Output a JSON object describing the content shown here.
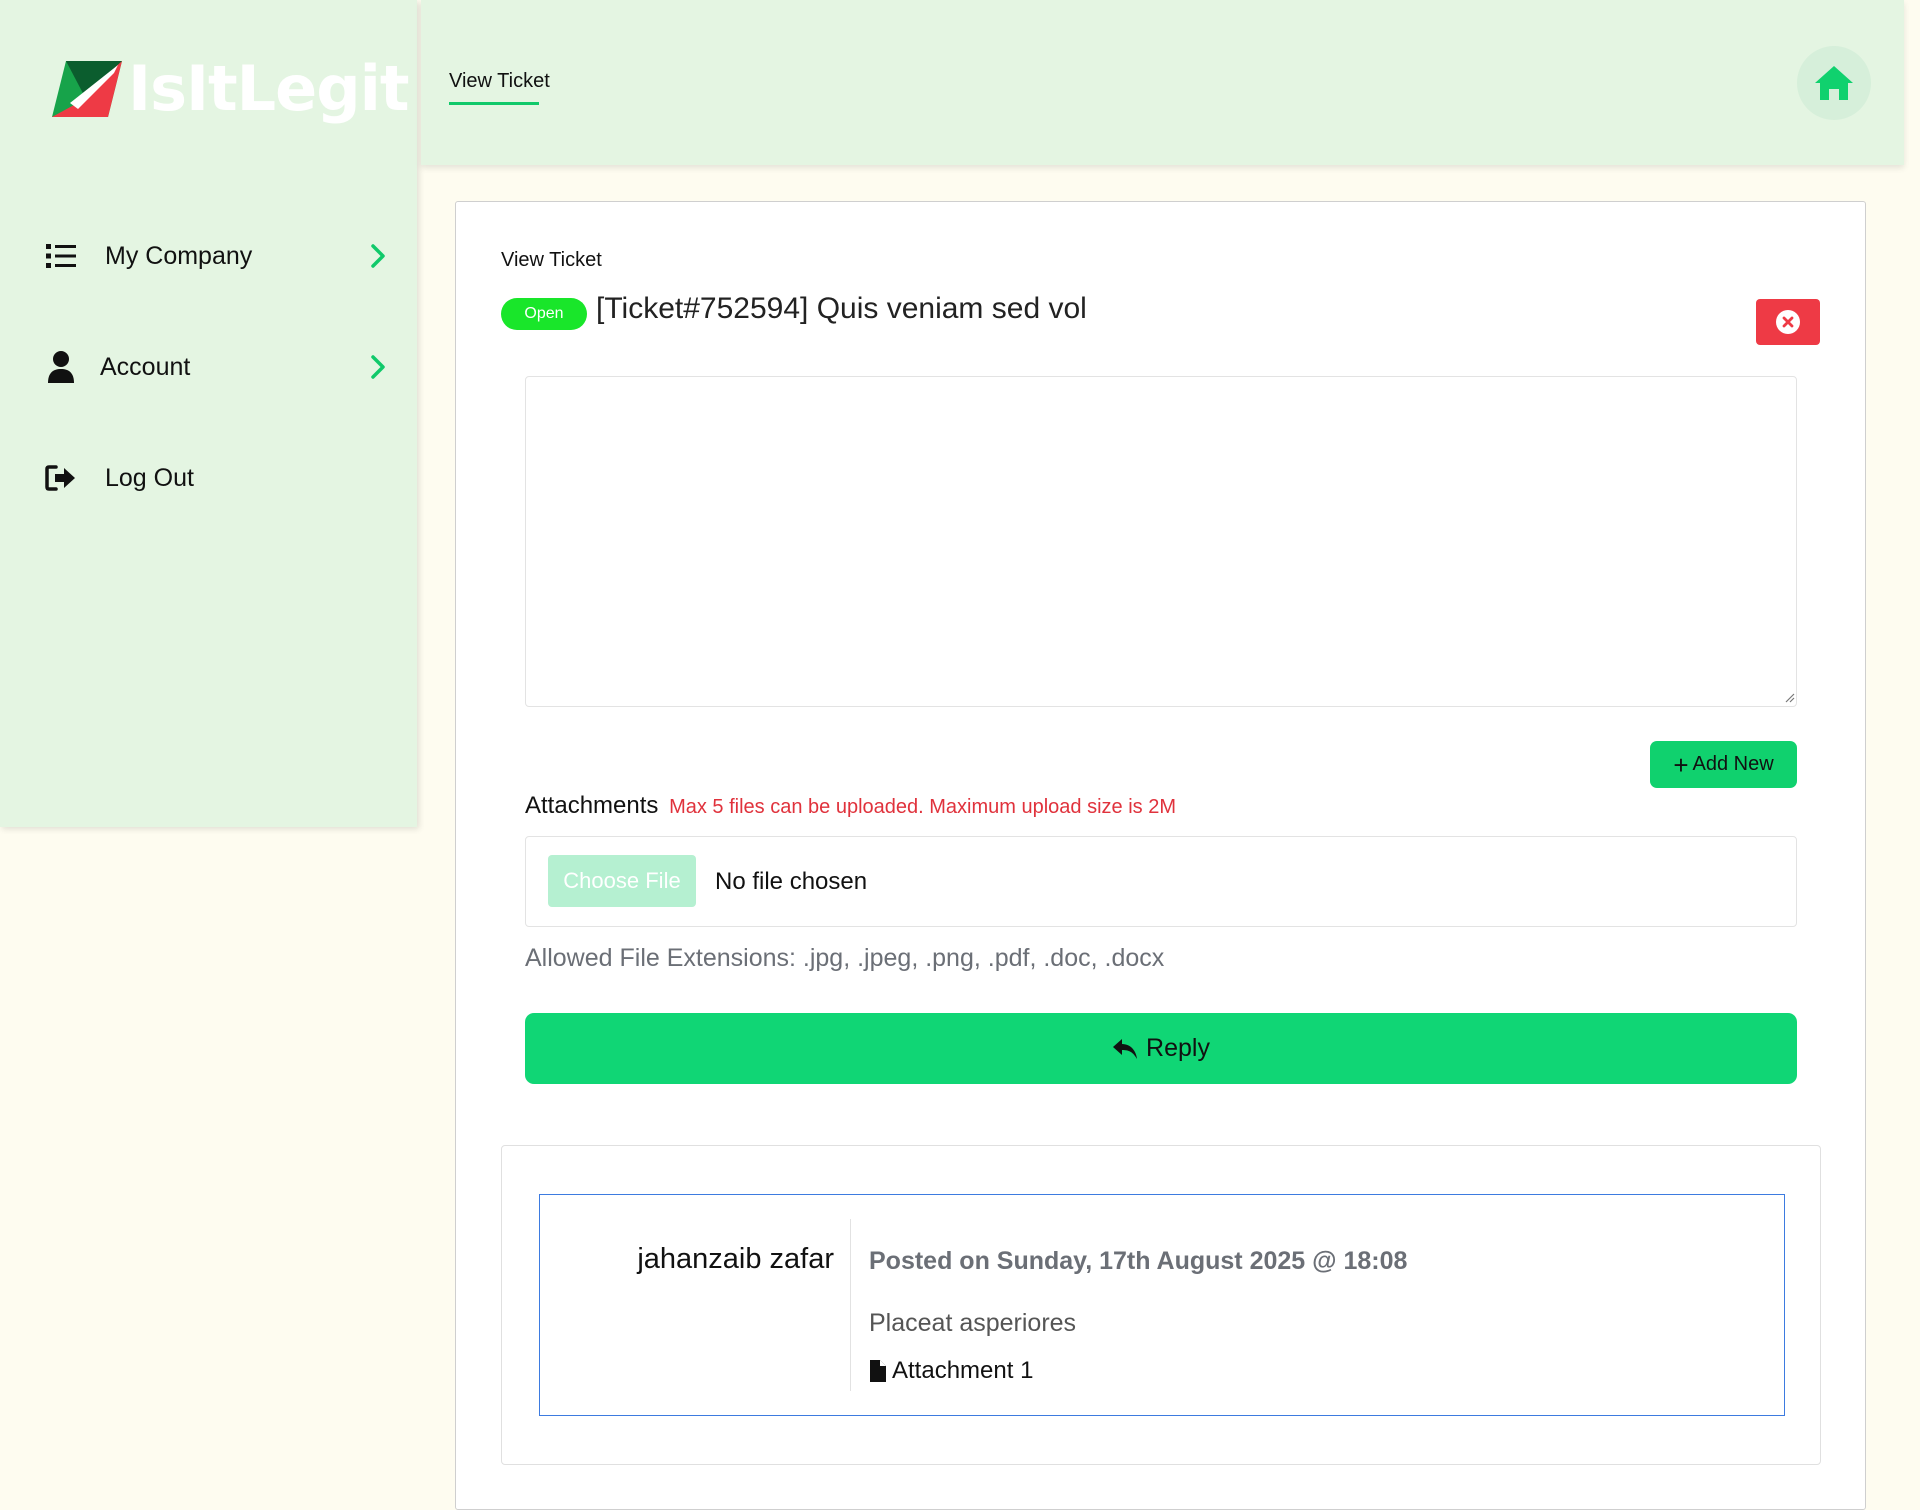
{
  "brand": {
    "name": "IsItLegit"
  },
  "sidebar": {
    "items": [
      {
        "label": "My Company",
        "icon": "list-icon"
      },
      {
        "label": "Account",
        "icon": "user-icon"
      },
      {
        "label": "Log Out",
        "icon": "sign-out-icon"
      }
    ]
  },
  "header": {
    "tab_label": "View Ticket",
    "home_icon": "home-icon"
  },
  "ticket": {
    "heading": "View Ticket",
    "status": "Open",
    "title": "[Ticket#752594] Quis veniam sed vol",
    "reply_text": "",
    "add_new_label": "Add New",
    "attachments_label": "Attachments",
    "attachments_note": "Max 5 files can be uploaded. Maximum upload size is 2M",
    "choose_file_label": "Choose File",
    "no_file_label": "No file chosen",
    "allowed_extensions": "Allowed File Extensions: .jpg, .jpeg, .png, .pdf, .doc, .docx",
    "reply_label": "Reply"
  },
  "thread": {
    "posts": [
      {
        "author": "jahanzaib zafar",
        "posted_on": "Posted on Sunday, 17th August 2025 @ 18:08",
        "body": "Placeat asperiores",
        "attachment_label": "Attachment 1"
      }
    ]
  },
  "colors": {
    "sidebar_bg": "#e4f5e2",
    "accent_green": "#10d675",
    "status_green": "#19e62a",
    "danger_red": "#ee3a45",
    "post_border": "#3d7be0"
  }
}
